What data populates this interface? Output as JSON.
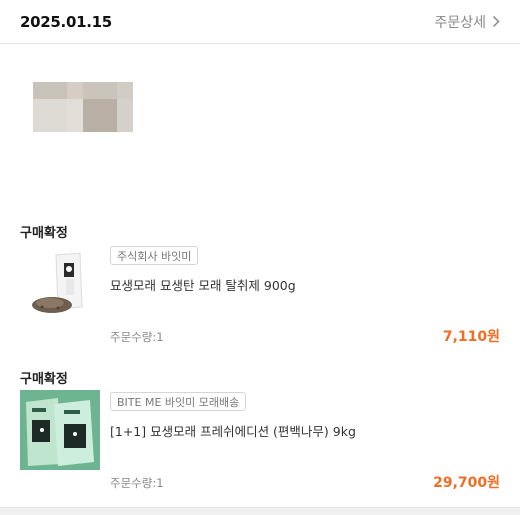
{
  "header": {
    "order_date": "2025.01.15",
    "detail_label": "주문상세"
  },
  "banner": {
    "colors": [
      "#c9c2b9",
      "#d6cec4",
      "#cbc4bb",
      "#d2ccc4",
      "#dedbd4",
      "#e2ddd6",
      "#b9afa5",
      "#d5d0c9"
    ]
  },
  "orders": [
    {
      "status": "구매확정",
      "seller": "주식회사 바잇미",
      "product_name": "묘생모래 묘생탄 모래 탈취제 900g",
      "quantity": "주문수량:1",
      "price": "7,110원"
    },
    {
      "status": "구매확정",
      "seller": "BITE ME 바잇미 모래배송",
      "product_name": "[1+1] 묘생모래 프레쉬에디션 (편백나무) 9kg",
      "quantity": "주문수량:1",
      "price": "29,700원"
    }
  ],
  "colors": {
    "price": "#f26d21",
    "product_thumb_bg": "#6db592"
  }
}
